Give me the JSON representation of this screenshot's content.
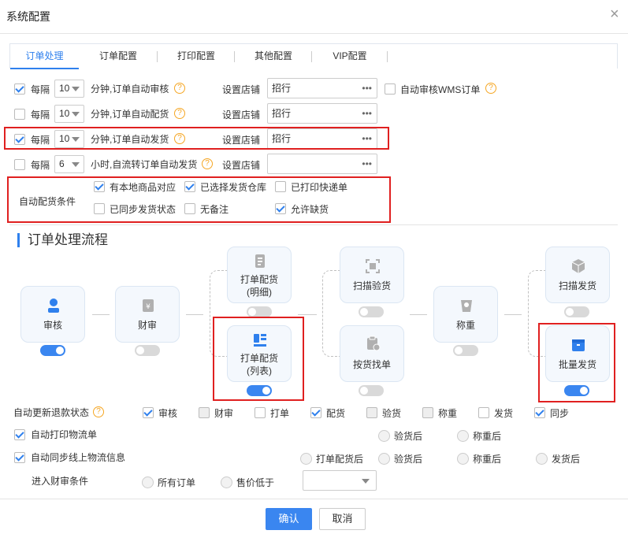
{
  "dialog": {
    "title": "系统配置",
    "close": "×"
  },
  "tabs": [
    {
      "label": "订单处理"
    },
    {
      "label": "订单配置"
    },
    {
      "label": "打印配置"
    },
    {
      "label": "其他配置"
    },
    {
      "label": "VIP配置"
    }
  ],
  "rows": [
    {
      "checked": true,
      "prefix": "每隔",
      "num": "10",
      "desc": "分钟,订单自动审核",
      "store_label": "设置店铺",
      "store_value": "招行",
      "extra": "自动审核WMS订单"
    },
    {
      "checked": false,
      "prefix": "每隔",
      "num": "10",
      "desc": "分钟,订单自动配货",
      "store_label": "设置店铺",
      "store_value": "招行"
    },
    {
      "checked": true,
      "prefix": "每隔",
      "num": "10",
      "desc": "分钟,订单自动发货",
      "store_label": "设置店铺",
      "store_value": "招行"
    },
    {
      "checked": false,
      "prefix": "每隔",
      "num": "6",
      "desc": "小时,自流转订单自动发货",
      "store_label": "设置店铺",
      "store_value": ""
    }
  ],
  "store_dots": "•••",
  "qmark": "?",
  "auto_conditions": {
    "label": "自动配货条件",
    "items": [
      {
        "label": "有本地商品对应",
        "checked": true
      },
      {
        "label": "已选择发货仓库",
        "checked": true
      },
      {
        "label": "已打印快递单",
        "checked": false
      },
      {
        "label": "已同步发货状态",
        "checked": false
      },
      {
        "label": "无备注",
        "checked": false
      },
      {
        "label": "允许缺货",
        "checked": true
      }
    ]
  },
  "flow": {
    "title": "订单处理流程",
    "nodes": {
      "audit": "审核",
      "finance": "财审",
      "pick_detail_1": "打单配货",
      "pick_detail_2": "(明细)",
      "pick_list_1": "打单配货",
      "pick_list_2": "(列表)",
      "scan_check": "扫描验货",
      "find_by_goods": "按货找单",
      "weigh": "称重",
      "scan_ship": "扫描发货",
      "batch_ship": "批量发货"
    }
  },
  "refund": {
    "label": "自动更新退款状态",
    "items": [
      {
        "label": "审核",
        "checked": true,
        "disabled": false
      },
      {
        "label": "财审",
        "checked": false,
        "disabled": true
      },
      {
        "label": "打单",
        "checked": false,
        "disabled": false
      },
      {
        "label": "配货",
        "checked": true,
        "disabled": false
      },
      {
        "label": "验货",
        "checked": false,
        "disabled": true
      },
      {
        "label": "称重",
        "checked": false,
        "disabled": true
      },
      {
        "label": "发货",
        "checked": false,
        "disabled": false
      },
      {
        "label": "同步",
        "checked": true,
        "disabled": false
      }
    ]
  },
  "auto_print": {
    "label": "自动打印物流单",
    "checked": true,
    "opt1": "验货后",
    "opt2": "称重后"
  },
  "auto_sync": {
    "label": "自动同步线上物流信息",
    "checked": true,
    "opt1": "打单配货后",
    "opt2": "验货后",
    "opt3": "称重后",
    "opt4": "发货后"
  },
  "finance_cond": {
    "label": "进入财审条件",
    "opt1": "所有订单",
    "opt2": "售价低于",
    "value": ""
  },
  "footer": {
    "confirm": "确认",
    "cancel": "取消"
  },
  "colors": {
    "accent": "#2f80ed",
    "highlight": "#e02020",
    "toggle_on": "#3a86f0"
  }
}
